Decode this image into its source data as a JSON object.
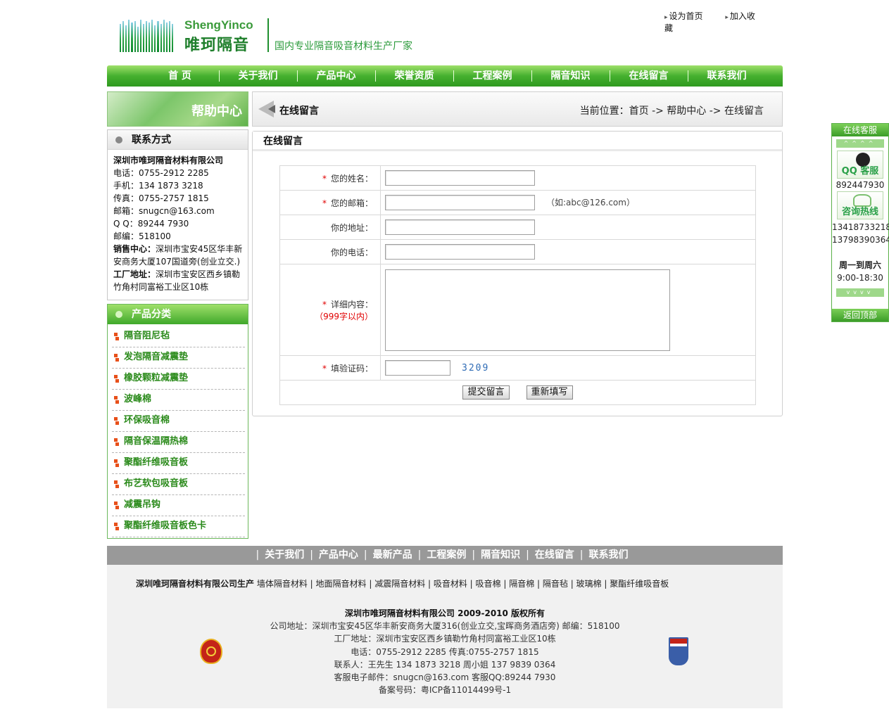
{
  "brand": {
    "name_en": "ShengYinco",
    "name_cn": "唯珂隔音",
    "slogan": "国内专业隔音吸音材料生产厂家"
  },
  "top_links": [
    "设为首页",
    "加入收藏"
  ],
  "nav": [
    "首 页",
    "关于我们",
    "产品中心",
    "荣誉资质",
    "工程案例",
    "隔音知识",
    "在线留言",
    "联系我们"
  ],
  "sidebar": {
    "banner": "帮助中心",
    "contact": {
      "title": "联系方式",
      "company": "深圳市唯珂隔音材料有限公司",
      "lines": [
        "电话：0755-2912 2285",
        "手机：134 1873 3218",
        "传真：0755-2757 1815",
        "邮箱：snugcn@163.com",
        "Q Q：89244 7930",
        "邮编：518100"
      ],
      "sales_label": "销售中心：",
      "sales_addr": "深圳市宝安45区华丰新安商务大厦107国道旁(创业立交.)",
      "factory_label": "工厂地址：",
      "factory_addr": "深圳市宝安区西乡镇勒竹角村同富裕工业区10栋"
    },
    "products": {
      "title": "产品分类",
      "items": [
        "隔音阻尼毡",
        "发泡隔音减震垫",
        "橡胶颗粒减震垫",
        "波峰棉",
        "环保吸音棉",
        "隔音保温隔热棉",
        "聚酯纤维吸音板",
        "布艺软包吸音板",
        "减震吊钩",
        "聚酯纤维吸音板色卡"
      ]
    }
  },
  "breadcrumb": {
    "title": "在线留言",
    "location": "当前位置：首页 -> 帮助中心 -> 在线留言"
  },
  "form": {
    "title": "在线留言",
    "name_label": "您的姓名：",
    "email_label": "您的邮箱：",
    "email_hint": "（如:abc@126.com）",
    "address_label": "你的地址：",
    "phone_label": "你的电话：",
    "content_label": "详细内容：",
    "content_limit": "（999字以内）",
    "captcha_label": "填验证码：",
    "captcha_code": "3209",
    "submit": "提交留言",
    "reset": "重新填写",
    "required_mark": "*"
  },
  "service": {
    "title": "在线客服",
    "qq_label": "QQ 客服",
    "qq_number": "892447930",
    "hotline_label": "咨询热线",
    "phones": [
      "13418733218",
      "13798390364"
    ],
    "days": "周一到周六",
    "hours": "9:00-18:30",
    "back_top": "返回顶部"
  },
  "footer": {
    "nav": [
      "关于我们",
      "产品中心",
      "最新产品",
      "工程案例",
      "隔音知识",
      "在线留言",
      "联系我们"
    ],
    "links_prefix": "深圳唯珂隔音材料有限公司生产",
    "links": "墙体隔音材料 | 地面隔音材料 | 减震隔音材料 | 吸音材料 | 吸音棉 | 隔音棉 | 隔音毡 | 玻璃棉 | 聚酯纤维吸音板",
    "copyright": "深圳市唯珂隔音材料有限公司 2009-2010 版权所有",
    "company_addr": "公司地址：深圳市宝安45区华丰新安商务大厦316(创业立交,宝晖商务酒店旁) 邮编：518100",
    "factory_addr": "工厂地址：深圳市宝安区西乡镇勒竹角村同富裕工业区10栋",
    "phone": "电话：0755-2912 2285 传真:0755-2757 1815",
    "contact": "联系人：王先生 134 1873 3218 周小姐 137 9839 0364",
    "email": "客服电子邮件：snugcn@163.com 客服QQ:89244 7930",
    "icp": "备案号码：粤ICP备11014499号-1"
  }
}
